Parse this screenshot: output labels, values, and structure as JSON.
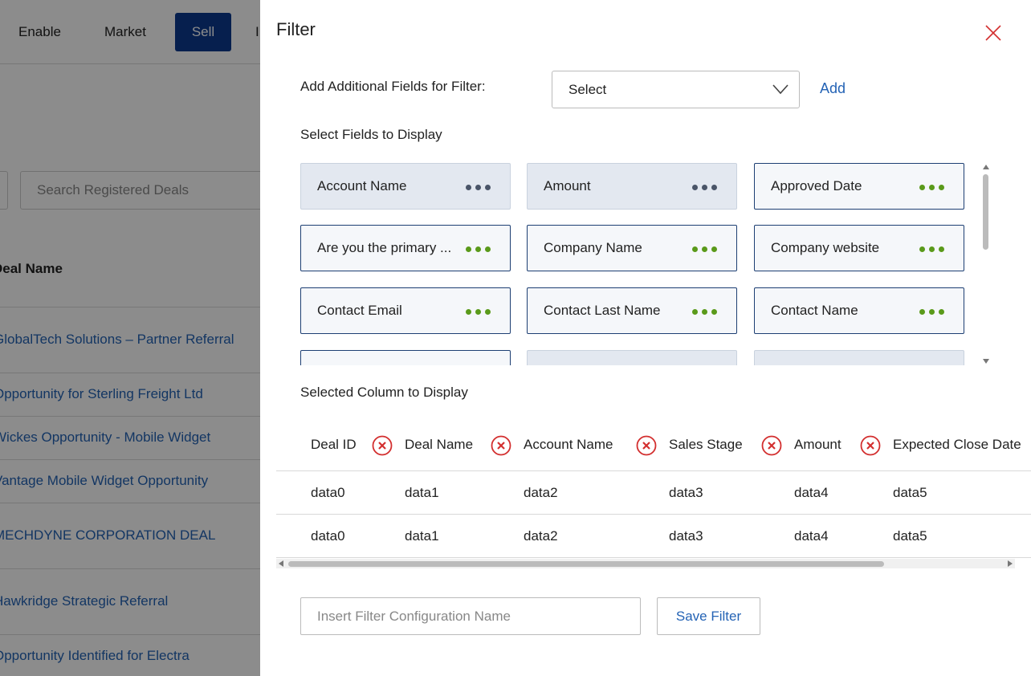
{
  "background": {
    "nav": [
      "Enable",
      "Market",
      "Sell",
      "I"
    ],
    "search_placeholder": "Search Registered Deals",
    "column_header": "Deal Name",
    "deals": [
      "GlobalTech Solutions – Partner Referral",
      "Opportunity for Sterling Freight Ltd",
      "Wickes Opportunity - Mobile Widget",
      "Vantage Mobile Widget Opportunity",
      "MECHDYNE CORPORATION DEAL",
      "Hawkridge Strategic Referral",
      "Opportunity Identified for Electra"
    ]
  },
  "panel": {
    "title": "Filter",
    "add_fields_label": "Add Additional Fields for Filter:",
    "select_value": "Select",
    "add_label": "Add",
    "fields_section_label": "Select Fields to Display",
    "fields": [
      {
        "label": "Account Name",
        "selected": true
      },
      {
        "label": "Amount",
        "selected": true
      },
      {
        "label": "Approved Date",
        "selected": false
      },
      {
        "label": "Are you the primary ...",
        "selected": false
      },
      {
        "label": "Company Name",
        "selected": false
      },
      {
        "label": "Company website",
        "selected": false
      },
      {
        "label": "Contact Email",
        "selected": false
      },
      {
        "label": "Contact Last Name",
        "selected": false
      },
      {
        "label": "Contact Name",
        "selected": false
      },
      {
        "label": "",
        "selected": false
      },
      {
        "label": "",
        "selected": true
      },
      {
        "label": "",
        "selected": true
      }
    ],
    "columns_section_label": "Selected Column to Display",
    "columns": [
      "Deal ID",
      "Deal Name",
      "Account Name",
      "Sales Stage",
      "Amount",
      "Expected Close Date"
    ],
    "rows": [
      [
        "data0",
        "data1",
        "data2",
        "data3",
        "data4",
        "data5"
      ],
      [
        "data0",
        "data1",
        "data2",
        "data3",
        "data4",
        "data5"
      ]
    ],
    "config_placeholder": "Insert Filter Configuration Name",
    "save_label": "Save Filter"
  },
  "colors": {
    "accent": "#2463b5",
    "nav_active": "#0b3a8f",
    "dots_green": "#5a9a1a",
    "remove_red": "#d32f2f"
  }
}
